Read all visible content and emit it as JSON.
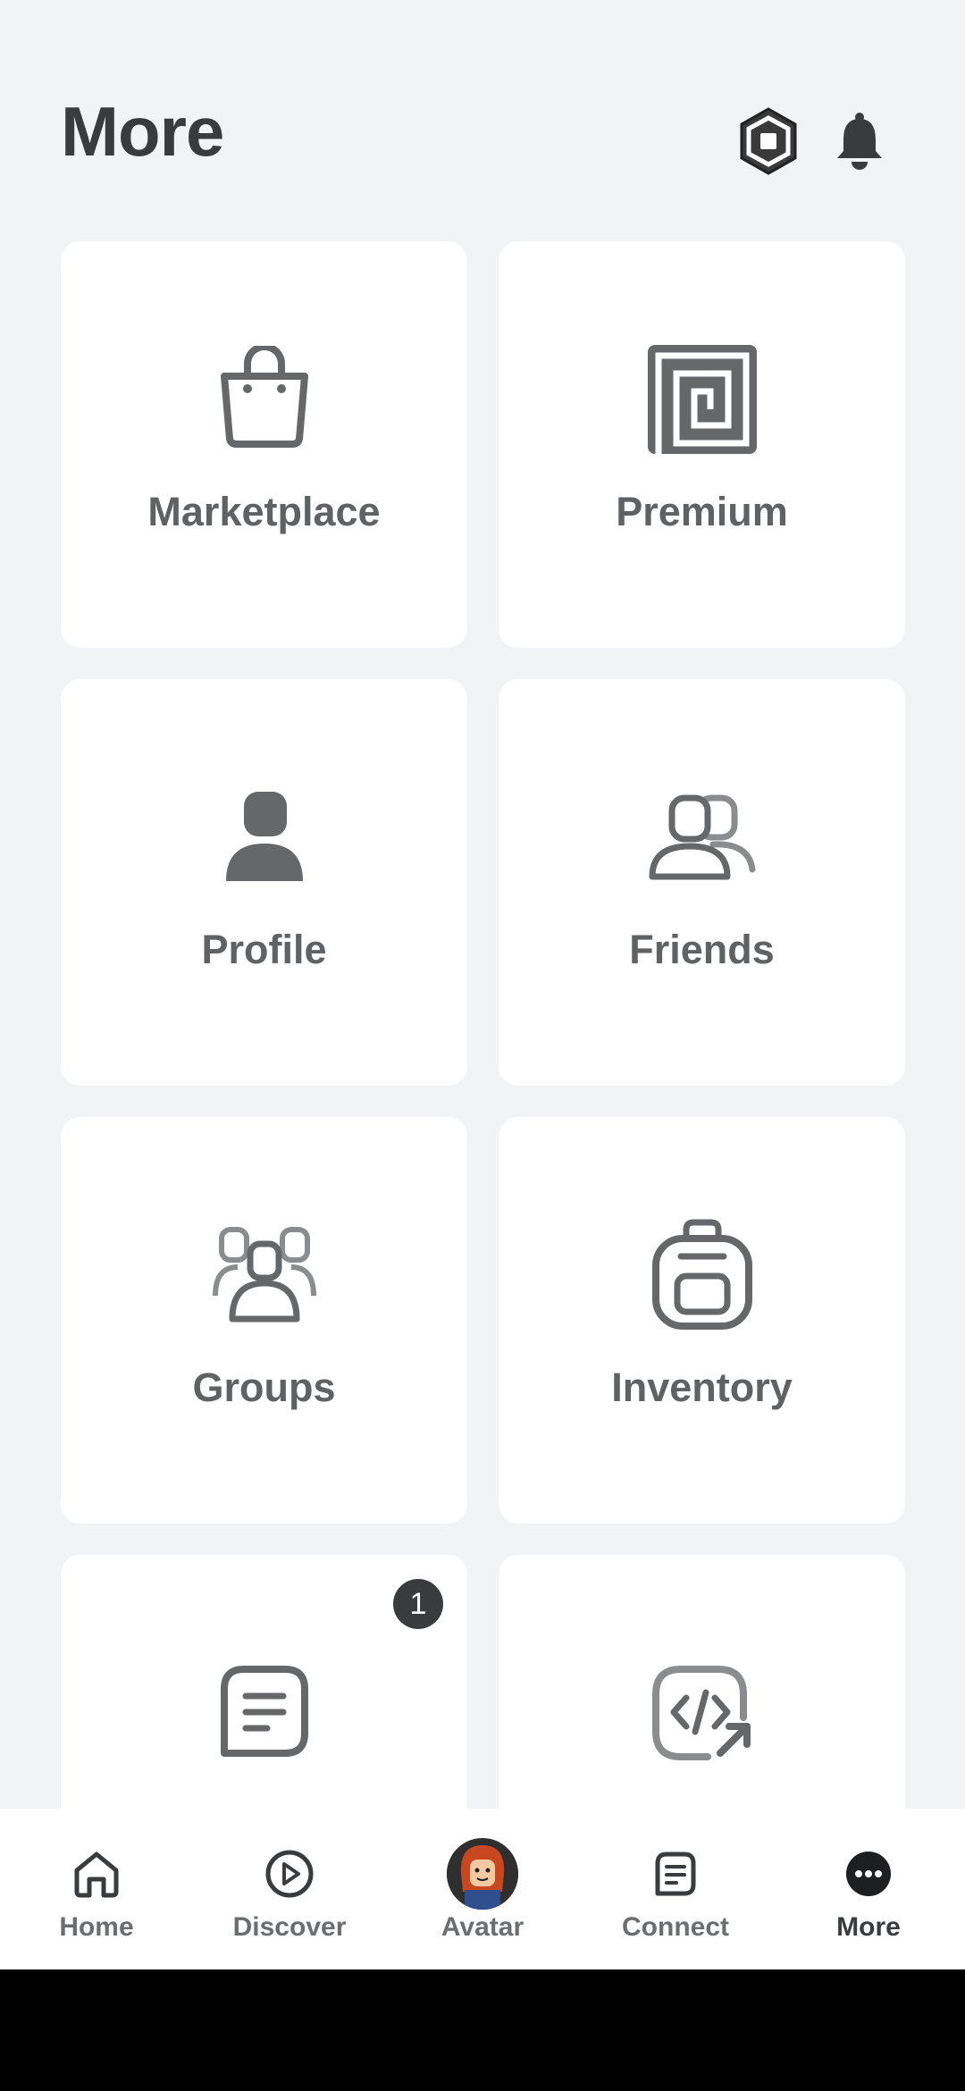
{
  "header": {
    "title": "More"
  },
  "tiles": [
    {
      "label": "Marketplace",
      "icon": "shopping-bag-icon"
    },
    {
      "label": "Premium",
      "icon": "premium-icon"
    },
    {
      "label": "Profile",
      "icon": "profile-icon"
    },
    {
      "label": "Friends",
      "icon": "friends-icon"
    },
    {
      "label": "Groups",
      "icon": "groups-icon"
    },
    {
      "label": "Inventory",
      "icon": "backpack-icon"
    },
    {
      "label": "",
      "icon": "message-icon",
      "badge": "1"
    },
    {
      "label": "",
      "icon": "developer-code-icon"
    }
  ],
  "nav": [
    {
      "label": "Home",
      "icon": "home-icon"
    },
    {
      "label": "Discover",
      "icon": "play-circle-icon"
    },
    {
      "label": "Avatar",
      "icon": "avatar-icon"
    },
    {
      "label": "Connect",
      "icon": "chat-icon"
    },
    {
      "label": "More",
      "icon": "more-icon",
      "active": true
    }
  ],
  "colors": {
    "background": "#f2f3f5",
    "tile": "#ffffff",
    "icon": "#656769",
    "text_dark": "#393b3d"
  }
}
